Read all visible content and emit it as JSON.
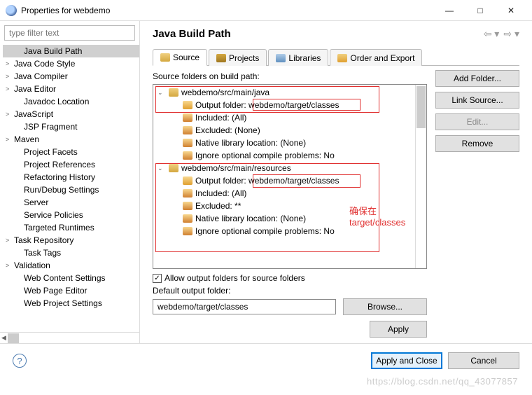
{
  "window": {
    "title": "Properties for webdemo"
  },
  "sidebar": {
    "filter_placeholder": "type filter text",
    "items": [
      {
        "label": "Java Build Path",
        "expandable": false,
        "selected": true,
        "indent": 1
      },
      {
        "label": "Java Code Style",
        "expandable": true
      },
      {
        "label": "Java Compiler",
        "expandable": true
      },
      {
        "label": "Java Editor",
        "expandable": true
      },
      {
        "label": "Javadoc Location",
        "expandable": false,
        "indent": 1
      },
      {
        "label": "JavaScript",
        "expandable": true
      },
      {
        "label": "JSP Fragment",
        "expandable": false,
        "indent": 1
      },
      {
        "label": "Maven",
        "expandable": true
      },
      {
        "label": "Project Facets",
        "expandable": false,
        "indent": 1
      },
      {
        "label": "Project References",
        "expandable": false,
        "indent": 1
      },
      {
        "label": "Refactoring History",
        "expandable": false,
        "indent": 1
      },
      {
        "label": "Run/Debug Settings",
        "expandable": false,
        "indent": 1
      },
      {
        "label": "Server",
        "expandable": false,
        "indent": 1
      },
      {
        "label": "Service Policies",
        "expandable": false,
        "indent": 1
      },
      {
        "label": "Targeted Runtimes",
        "expandable": false,
        "indent": 1
      },
      {
        "label": "Task Repository",
        "expandable": true
      },
      {
        "label": "Task Tags",
        "expandable": false,
        "indent": 1
      },
      {
        "label": "Validation",
        "expandable": true
      },
      {
        "label": "Web Content Settings",
        "expandable": false,
        "indent": 1
      },
      {
        "label": "Web Page Editor",
        "expandable": false,
        "indent": 1
      },
      {
        "label": "Web Project Settings",
        "expandable": false,
        "indent": 1
      }
    ]
  },
  "content": {
    "heading": "Java Build Path",
    "tabs": [
      {
        "label": "Source",
        "icon": "ic-source",
        "active": true
      },
      {
        "label": "Projects",
        "icon": "ic-projects"
      },
      {
        "label": "Libraries",
        "icon": "ic-libraries"
      },
      {
        "label": "Order and Export",
        "icon": "ic-order"
      }
    ],
    "folders_label": "Source folders on build path:",
    "source_folders": [
      {
        "path": "webdemo/src/main/java",
        "attrs": [
          {
            "key": "Output folder",
            "val": "webdemo/target/classes",
            "icon": "outico"
          },
          {
            "key": "Included",
            "val": "(All)",
            "icon": "attrico"
          },
          {
            "key": "Excluded",
            "val": "(None)",
            "icon": "attrico"
          },
          {
            "key": "Native library location",
            "val": "(None)",
            "icon": "attrico"
          },
          {
            "key": "Ignore optional compile problems",
            "val": "No",
            "icon": "attrico"
          }
        ]
      },
      {
        "path": "webdemo/src/main/resources",
        "attrs": [
          {
            "key": "Output folder",
            "val": "webdemo/target/classes",
            "icon": "outico"
          },
          {
            "key": "Included",
            "val": "(All)",
            "icon": "attrico"
          },
          {
            "key": "Excluded",
            "val": "**",
            "icon": "attrico"
          },
          {
            "key": "Native library location",
            "val": "(None)",
            "icon": "attrico"
          },
          {
            "key": "Ignore optional compile problems",
            "val": "No",
            "icon": "attrico"
          }
        ]
      }
    ],
    "buttons": {
      "add_folder": "Add Folder...",
      "link_source": "Link Source...",
      "edit": "Edit...",
      "remove": "Remove",
      "browse": "Browse...",
      "apply": "Apply"
    },
    "allow_output_label": "Allow output folders for source folders",
    "allow_output_checked": true,
    "default_output_label": "Default output folder:",
    "default_output_value": "webdemo/target/classes",
    "annotation": "确保在target/classes"
  },
  "footer": {
    "apply_close": "Apply and Close",
    "cancel": "Cancel"
  },
  "watermark": "https://blog.csdn.net/qq_43077857"
}
